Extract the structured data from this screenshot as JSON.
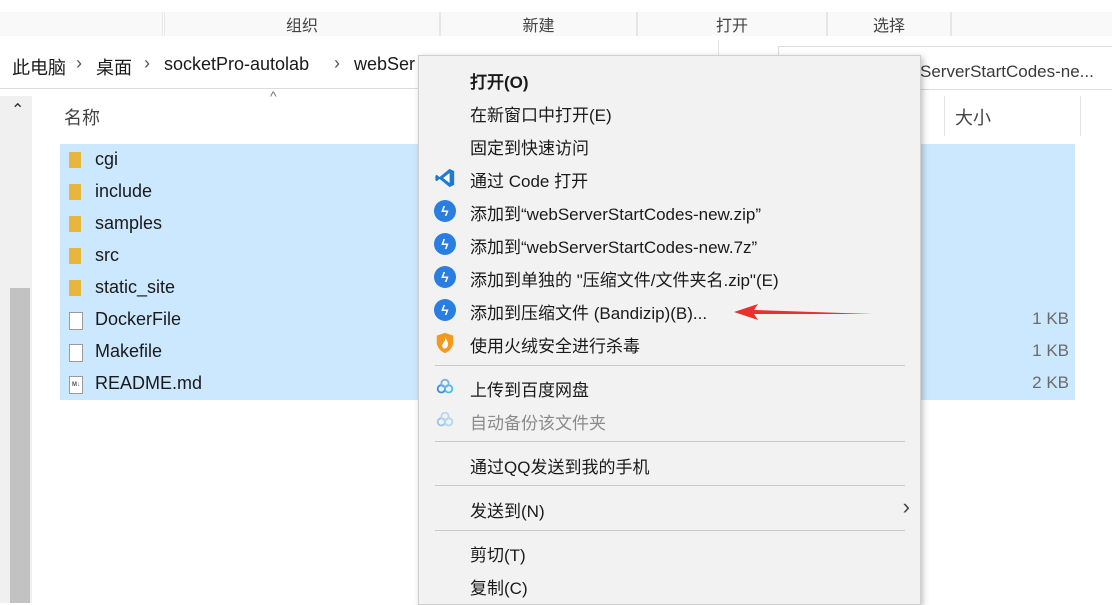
{
  "ribbon": {
    "organize": "组织",
    "new": "新建",
    "open": "打开",
    "select": "选择"
  },
  "breadcrumb": {
    "items": [
      "此电脑",
      "桌面",
      "socketPro-autolab",
      "webSer"
    ],
    "separator": "›"
  },
  "search": {
    "value": "ServerStartCodes-ne..."
  },
  "columns": {
    "name": "名称",
    "size": "大小"
  },
  "files": [
    {
      "name": "cgi",
      "type": "folder",
      "size": ""
    },
    {
      "name": "include",
      "type": "folder",
      "size": ""
    },
    {
      "name": "samples",
      "type": "folder",
      "size": ""
    },
    {
      "name": "src",
      "type": "folder",
      "size": ""
    },
    {
      "name": "static_site",
      "type": "folder",
      "size": ""
    },
    {
      "name": "DockerFile",
      "type": "file",
      "size": "1 KB"
    },
    {
      "name": "Makefile",
      "type": "file",
      "size": "1 KB"
    },
    {
      "name": "README.md",
      "type": "md",
      "size": "2 KB"
    }
  ],
  "context_menu": {
    "open": "打开(O)",
    "open_new_window": "在新窗口中打开(E)",
    "pin_quick_access": "固定到快速访问",
    "open_with_code": "通过 Code 打开",
    "add_zip": "添加到“webServerStartCodes-new.zip”",
    "add_7z": "添加到“webServerStartCodes-new.7z”",
    "add_separate": "添加到单独的 \"压缩文件/文件夹名.zip\"(E)",
    "add_bandizip": "添加到压缩文件 (Bandizip)(B)...",
    "huorong_scan": "使用火绒安全进行杀毒",
    "upload_baidu": "上传到百度网盘",
    "auto_backup": "自动备份该文件夹",
    "send_qq": "通过QQ发送到我的手机",
    "send_to": "发送到(N)",
    "cut": "剪切(T)",
    "copy": "复制(C)"
  },
  "colors": {
    "selection": "#cce8ff",
    "accent": "#2a7de1",
    "arrow": "#e8312a",
    "folder": "#e8b63a"
  },
  "icons": {
    "vscode": "vscode-icon",
    "bandizip": "bandizip-icon",
    "huorong": "huorong-shield-icon",
    "baidu": "baidu-netdisk-icon"
  }
}
